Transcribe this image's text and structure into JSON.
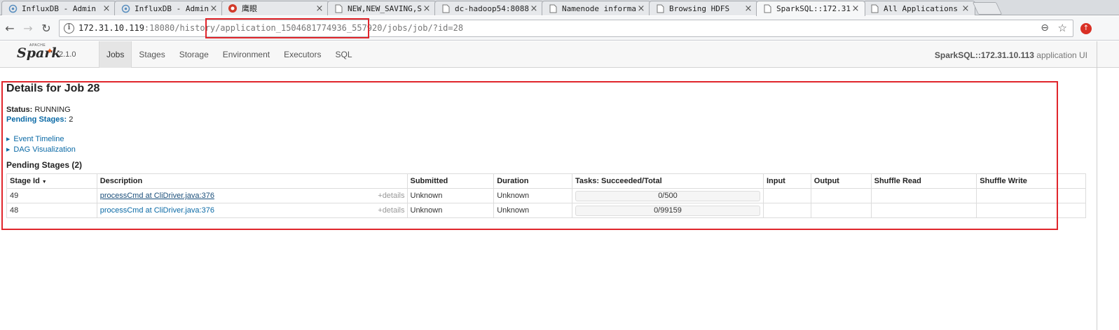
{
  "browser": {
    "tabs": [
      {
        "title": "InfluxDB - Admin",
        "icon": "influx-icon"
      },
      {
        "title": "InfluxDB - Admin",
        "icon": "influx-icon"
      },
      {
        "title": "鹰眼",
        "icon": "eagle-eye-icon"
      },
      {
        "title": "NEW,NEW_SAVING,S",
        "icon": "page-icon"
      },
      {
        "title": "dc-hadoop54:8088",
        "icon": "page-icon"
      },
      {
        "title": "Namenode informa",
        "icon": "page-icon"
      },
      {
        "title": "Browsing HDFS",
        "icon": "page-icon"
      },
      {
        "title": "SparkSQL::172.31",
        "icon": "page-icon",
        "active": true
      },
      {
        "title": "All Applications",
        "icon": "page-icon"
      }
    ],
    "url_host": "172.31.10.119",
    "url_rest": ":18080/history/application_1504681774936_557920/jobs/job/?id=28"
  },
  "spark": {
    "version": "2.1.0",
    "nav": [
      "Jobs",
      "Stages",
      "Storage",
      "Environment",
      "Executors",
      "SQL"
    ],
    "active_nav": "Jobs",
    "app_name": "SparkSQL::172.31.10.113",
    "app_suffix": " application UI"
  },
  "job": {
    "title": "Details for Job 28",
    "status_label": "Status:",
    "status_value": " RUNNING",
    "pending_label": "Pending Stages:",
    "pending_value": " 2",
    "event_timeline": "Event Timeline",
    "dag_visualization": "DAG Visualization",
    "section_title": "Pending Stages (2)"
  },
  "table": {
    "headers": [
      "Stage Id",
      "Description",
      "Submitted",
      "Duration",
      "Tasks: Succeeded/Total",
      "Input",
      "Output",
      "Shuffle Read",
      "Shuffle Write"
    ],
    "details_label": "+details",
    "rows": [
      {
        "stage_id": "49",
        "description": "processCmd at CliDriver.java:376",
        "submitted": "Unknown",
        "duration": "Unknown",
        "tasks": "0/500",
        "progress": 0,
        "input": "",
        "output": "",
        "shuffle_read": "",
        "shuffle_write": ""
      },
      {
        "stage_id": "48",
        "description": "processCmd at CliDriver.java:376",
        "submitted": "Unknown",
        "duration": "Unknown",
        "tasks": "0/99159",
        "progress": 0,
        "input": "",
        "output": "",
        "shuffle_read": "",
        "shuffle_write": ""
      }
    ]
  },
  "colors": {
    "annotation": "#e0252b",
    "link": "#0b6aa6",
    "spark_flame": "#e25a1c"
  }
}
